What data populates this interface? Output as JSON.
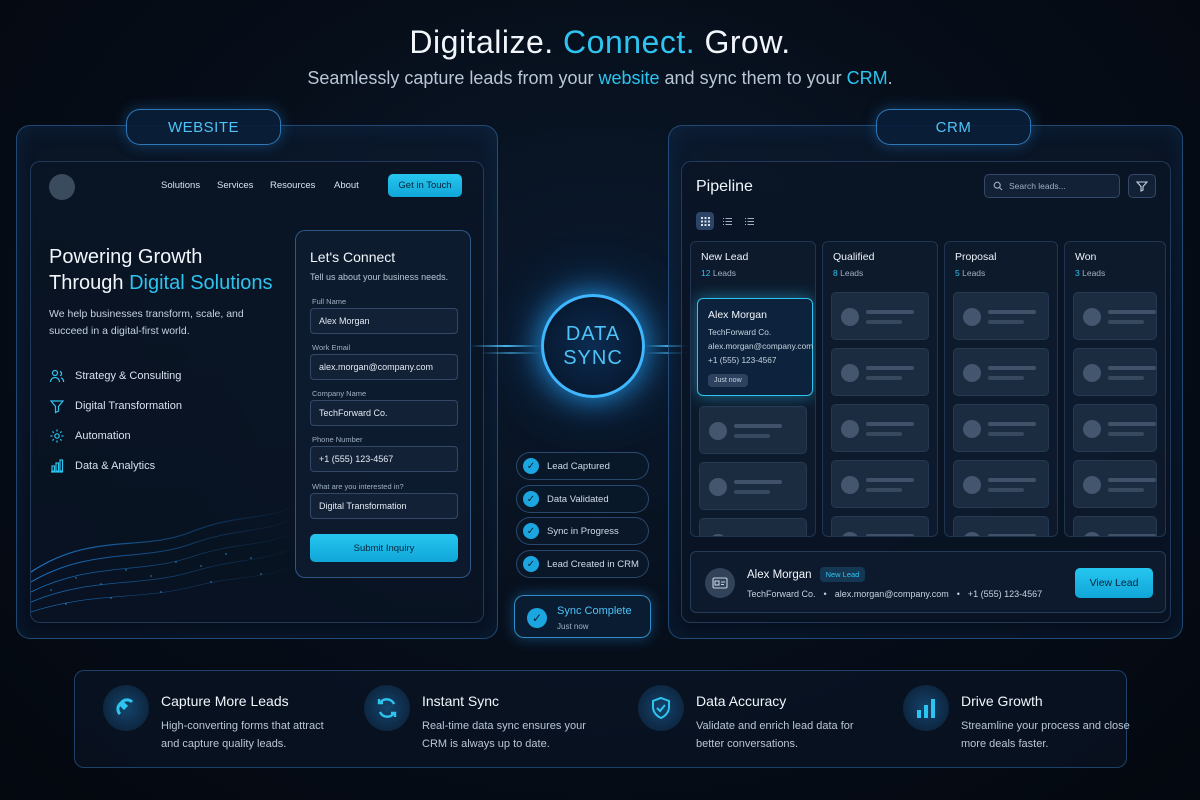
{
  "hero": {
    "title_a": "Digitalize.",
    "title_b": "Connect.",
    "title_c": "Grow.",
    "sub_a": "Seamlessly capture leads from your",
    "sub_website": "website",
    "sub_b": "and sync them to your",
    "sub_crm": "CRM",
    "sub_end": "."
  },
  "website": {
    "tag": "WEBSITE",
    "nav": [
      "Solutions",
      "Services",
      "Resources",
      "About"
    ],
    "cta": "Get in Touch",
    "heading_line1": "Powering Growth",
    "heading_line2a": "Through",
    "heading_line2b": "Digital Solutions",
    "description": "We help businesses transform, scale, and succeed in a digital-first world.",
    "features": [
      "Strategy & Consulting",
      "Digital Transformation",
      "Automation",
      "Data & Analytics"
    ],
    "form": {
      "title": "Let's Connect",
      "subtitle": "Tell us about your business needs.",
      "fields": [
        {
          "label": "Full Name",
          "value": "Alex Morgan"
        },
        {
          "label": "Work Email",
          "value": "alex.morgan@company.com"
        },
        {
          "label": "Company Name",
          "value": "TechForward Co."
        },
        {
          "label": "Phone Number",
          "value": "+1 (555) 123-4567"
        },
        {
          "label": "What are you interested in?",
          "value": "Digital Transformation"
        }
      ],
      "submit": "Submit Inquiry"
    }
  },
  "sync": {
    "line1": "DATA",
    "line2": "SYNC",
    "steps": [
      "Lead Captured",
      "Data Validated",
      "Sync in Progress",
      "Lead Created in CRM"
    ],
    "complete_title": "Sync Complete",
    "complete_time": "Just now"
  },
  "crm": {
    "tag": "CRM",
    "title": "Pipeline",
    "search_placeholder": "Search leads...",
    "columns": [
      {
        "title": "New Lead",
        "count": "12",
        "suffix": "Leads"
      },
      {
        "title": "Qualified",
        "count": "8",
        "suffix": "Leads"
      },
      {
        "title": "Proposal",
        "count": "5",
        "suffix": "Leads"
      },
      {
        "title": "Won",
        "count": "3",
        "suffix": "Leads"
      }
    ],
    "lead_card": {
      "name": "Alex Morgan",
      "company": "TechForward Co.",
      "email": "alex.morgan@company.com",
      "phone": "+1 (555) 123-4567",
      "time": "Just now"
    },
    "detail": {
      "name": "Alex Morgan",
      "badge": "New Lead",
      "company": "TechForward Co.",
      "sep": "•",
      "email": "alex.morgan@company.com",
      "phone": "+1 (555) 123-4567",
      "button": "View Lead"
    }
  },
  "benefits": [
    {
      "title": "Capture More Leads",
      "desc": "High-converting forms that attract and capture quality leads.",
      "icon": "magnet-icon"
    },
    {
      "title": "Instant Sync",
      "desc": "Real-time data sync ensures your CRM is always up to date.",
      "icon": "refresh-icon"
    },
    {
      "title": "Data Accuracy",
      "desc": "Validate and enrich lead data for better conversations.",
      "icon": "shield-check-icon"
    },
    {
      "title": "Drive Growth",
      "desc": "Streamline your process and close more deals faster.",
      "icon": "bar-chart-icon"
    }
  ],
  "colors": {
    "accent": "#2ec4f0",
    "background": "#060d18",
    "panel_border": "#408cdc"
  }
}
